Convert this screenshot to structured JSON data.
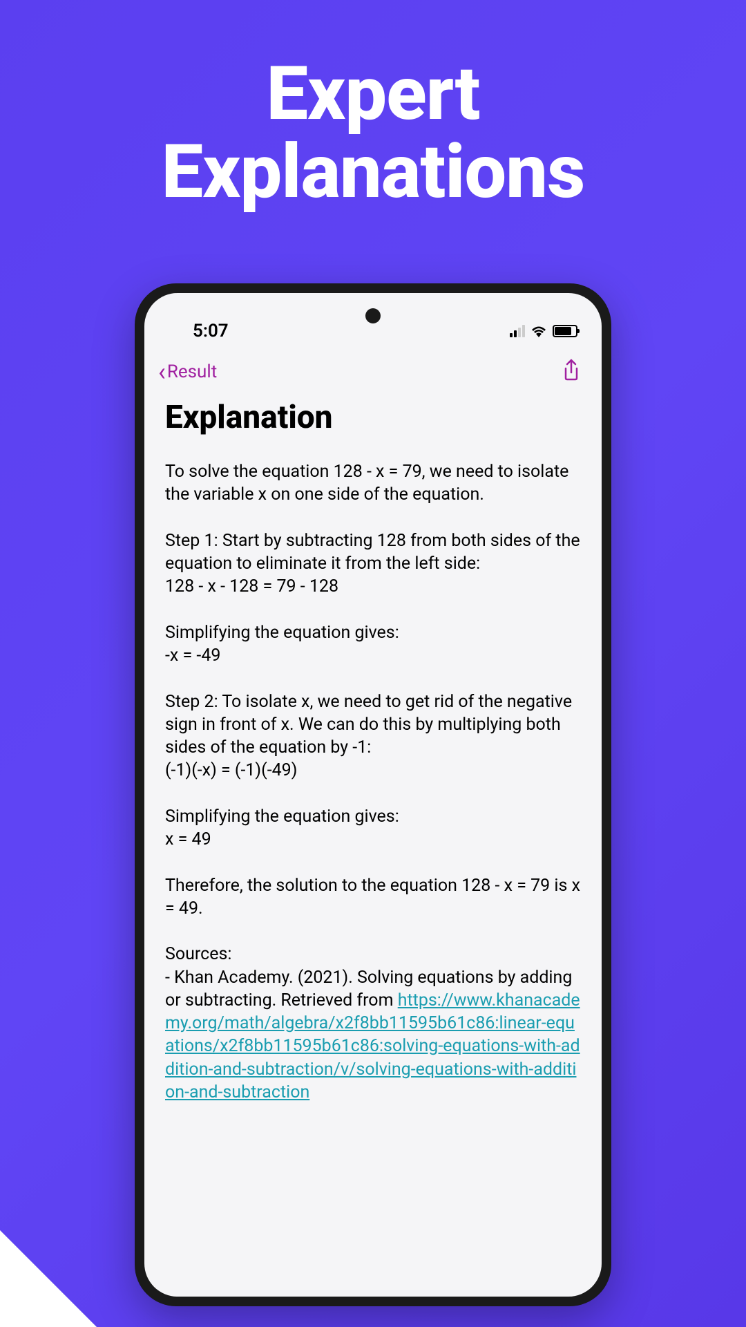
{
  "hero": {
    "title_line1": "Expert",
    "title_line2": "Explanations"
  },
  "statusBar": {
    "time": "5:07"
  },
  "navBar": {
    "backLabel": "Result"
  },
  "content": {
    "heading": "Explanation",
    "intro": "To solve the equation 128 - x = 79, we need to isolate the variable x on one side of the equation.",
    "step1_label": "Step 1: Start by subtracting 128 from both sides of the equation to eliminate it from the left side:",
    "step1_eq": "128 - x - 128 = 79 - 128",
    "simplify1_label": "Simplifying the equation gives:",
    "simplify1_eq": "-x = -49",
    "step2_label": "Step 2: To isolate x, we need to get rid of the negative sign in front of x. We can do this by multiplying both sides of the equation by -1:",
    "step2_eq": "(-1)(-x) = (-1)(-49)",
    "simplify2_label": "Simplifying the equation gives:",
    "simplify2_eq": "x = 49",
    "conclusion": "Therefore, the solution to the equation 128 - x = 79 is x = 49.",
    "sources_label": "Sources:",
    "source_text": "- Khan Academy. (2021). Solving equations by adding or subtracting. Retrieved from ",
    "source_link": "https://www.khanacademy.org/math/algebra/x2f8bb11595b61c86:linear-equations/x2f8bb11595b61c86:solving-equations-with-addition-and-subtraction/v/solving-equations-with-addition-and-subtraction"
  }
}
